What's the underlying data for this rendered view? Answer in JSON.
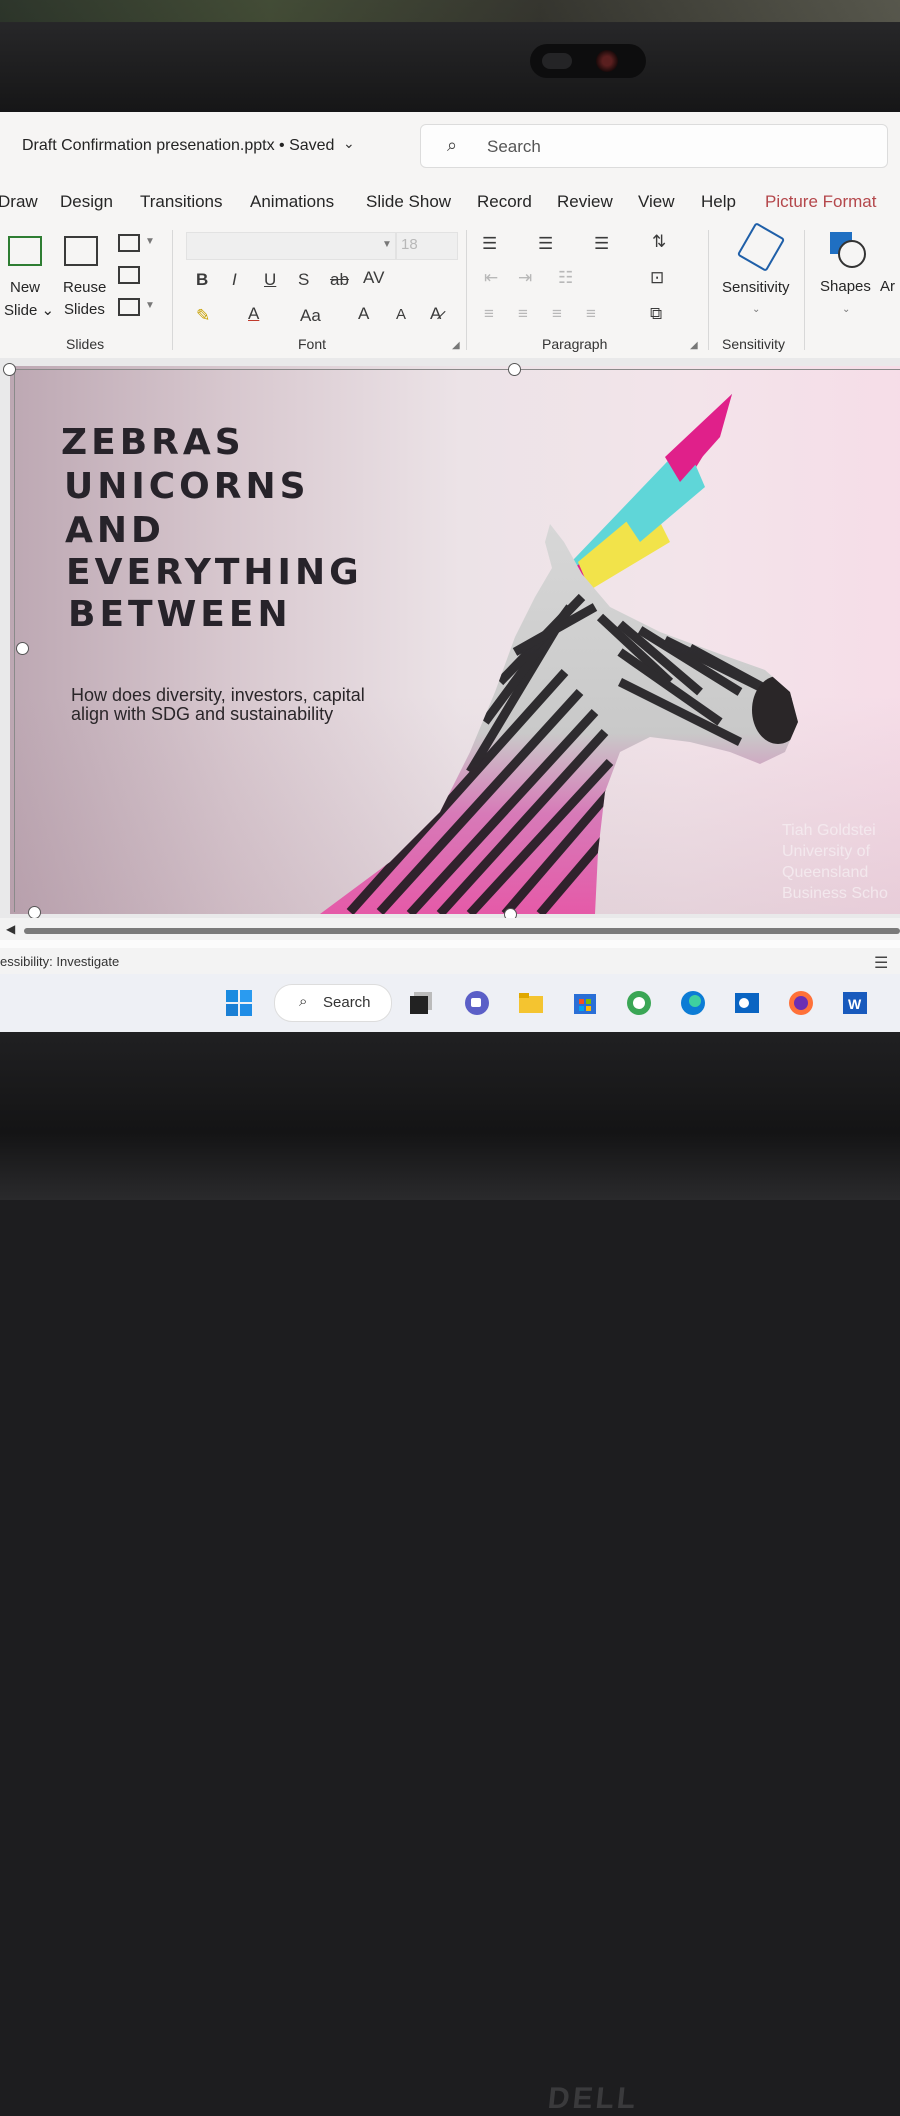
{
  "window": {
    "doc_title": "Draft Confirmation presenation.pptx • Saved",
    "search_placeholder": "Search"
  },
  "ribbon_tabs": [
    "Draw",
    "Design",
    "Transitions",
    "Animations",
    "Slide Show",
    "Record",
    "Review",
    "View",
    "Help",
    "Picture Format"
  ],
  "ribbon": {
    "slides_group": {
      "new_slide_line1": "New",
      "new_slide_line2": "Slide ⌄",
      "reuse_line1": "Reuse",
      "reuse_line2": "Slides",
      "label": "Slides"
    },
    "font_group": {
      "font_size": "18",
      "bold": "B",
      "italic": "I",
      "underline": "U",
      "shadow": "S",
      "strike": "ab",
      "spacing": "AV",
      "change_case": "Aa",
      "grow": "A",
      "shrink": "A",
      "label": "Font"
    },
    "paragraph_group": {
      "label": "Paragraph"
    },
    "sensitivity_group": {
      "button": "Sensitivity",
      "label": "Sensitivity"
    },
    "shapes_button": "Shapes",
    "arrange_partial": "Ar"
  },
  "slide": {
    "title_lines": [
      "ZEBRAS",
      "UNICORNS",
      "AND",
      "EVERYTHING",
      "BETWEEN"
    ],
    "subtitle": "How does diversity, investors, capital align with SDG and sustainability",
    "author_lines": [
      "Tiah Goldstei",
      "University of",
      "Queensland",
      "Business Scho"
    ]
  },
  "status": {
    "accessibility": "essibility: Investigate"
  },
  "taskbar": {
    "search_label": "Search",
    "apps": [
      "windows-start",
      "search",
      "task-view",
      "teams-chat",
      "file-explorer",
      "microsoft-store",
      "globe-app",
      "edge",
      "outlook",
      "firefox",
      "word"
    ]
  },
  "colors": {
    "accent_tab": "#b4474b",
    "slide_bg_left": "#bda8b3",
    "slide_bg_right": "#f6dde8",
    "title_text": "#27232a",
    "horn_pink": "#e0208a",
    "horn_cyan": "#5fd6d8",
    "horn_yellow": "#f2e34a"
  },
  "brand": "DELL"
}
